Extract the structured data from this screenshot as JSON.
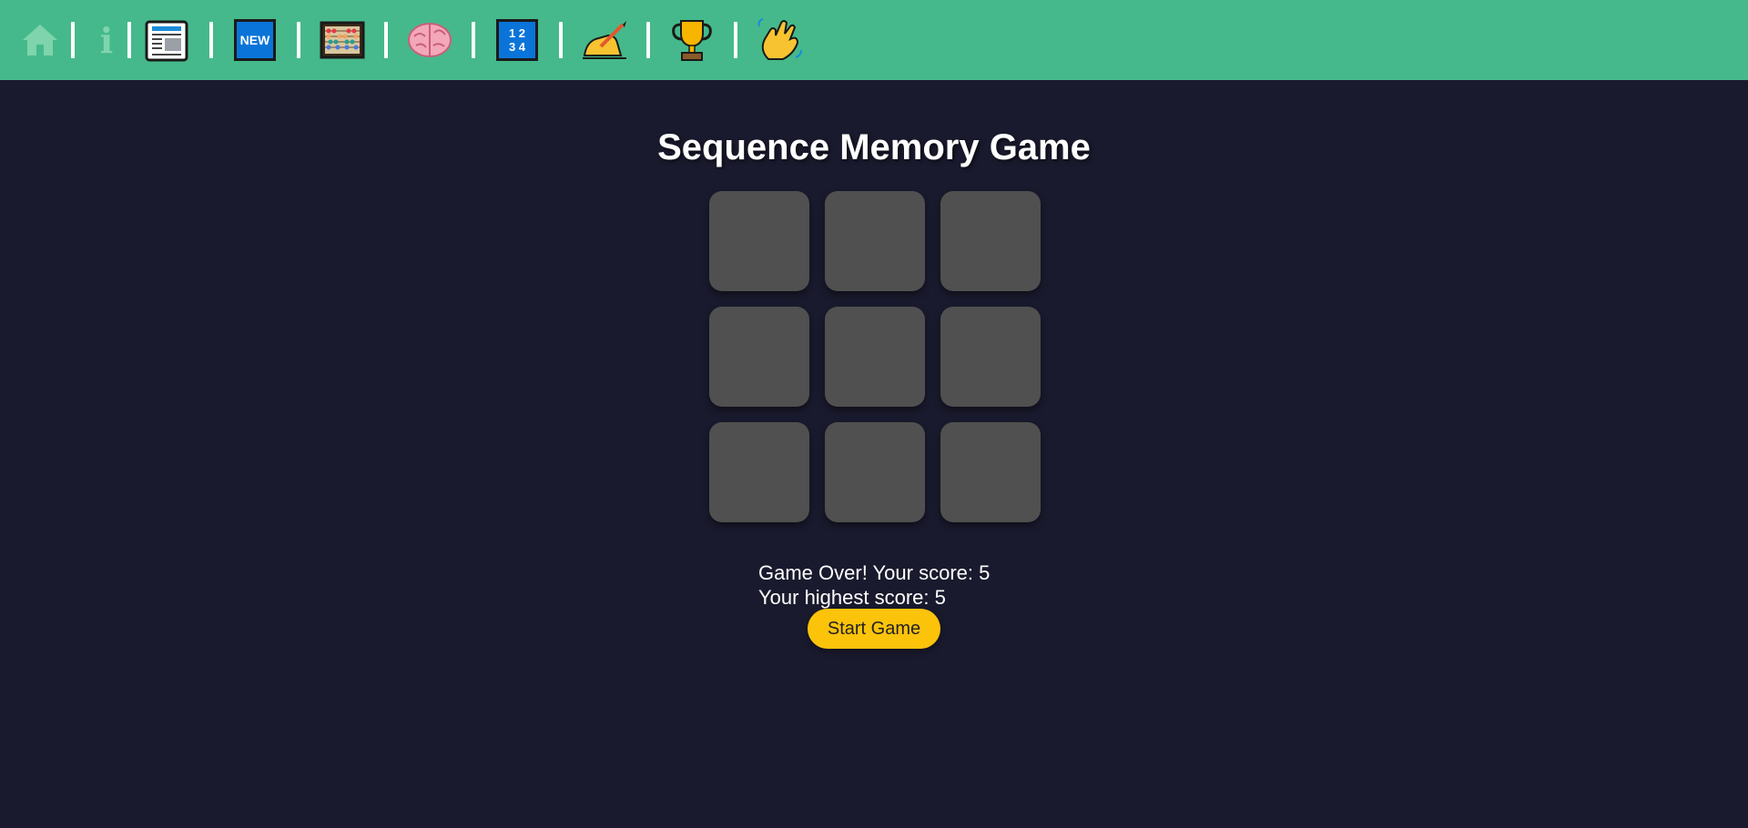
{
  "nav": {
    "icons": [
      "home-icon",
      "info-icon",
      "newspaper-icon",
      "new-badge-icon",
      "abacus-icon",
      "brain-icon",
      "numbers-1234-icon",
      "writing-hand-icon",
      "trophy-icon",
      "waving-hand-icon"
    ],
    "info_glyph": "i",
    "new_label": "NEW",
    "numbers_top": "1 2",
    "numbers_bottom": "3 4"
  },
  "game": {
    "title": "Sequence Memory Game",
    "tile_count": 9,
    "status_line": "Game Over! Your score: 5",
    "highest_line": "Your highest score: 5",
    "start_label": "Start Game"
  },
  "colors": {
    "topbar": "#45b98b",
    "background": "#1a1a2e",
    "tile": "#505050",
    "button": "#fcc30b"
  }
}
